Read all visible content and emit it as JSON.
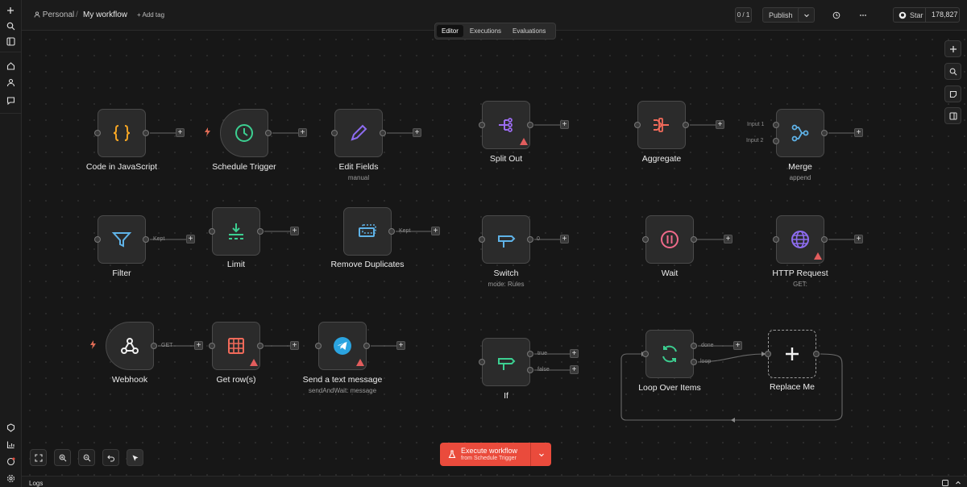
{
  "breadcrumb": {
    "project": "Personal",
    "separator": "/",
    "workflow": "My workflow",
    "add_tag": "+ Add tag"
  },
  "header": {
    "counter": "0 / 1",
    "publish_label": "Publish",
    "star_label": "Star",
    "star_count": "178,827"
  },
  "tabs": [
    {
      "label": "Editor",
      "active": true
    },
    {
      "label": "Executions",
      "active": false
    },
    {
      "label": "Evaluations",
      "active": false
    }
  ],
  "nodes": {
    "code": {
      "label": "Code in JavaScript"
    },
    "schedule": {
      "label": "Schedule Trigger"
    },
    "edit_fields": {
      "label": "Edit Fields",
      "sub": "manual"
    },
    "split_out": {
      "label": "Split Out"
    },
    "aggregate": {
      "label": "Aggregate"
    },
    "merge": {
      "label": "Merge",
      "sub": "append",
      "input1": "Input 1",
      "input2": "Input 2"
    },
    "filter": {
      "label": "Filter",
      "edge": "Kept"
    },
    "limit": {
      "label": "Limit"
    },
    "remove_dup": {
      "label": "Remove Duplicates",
      "edge": "Kept"
    },
    "switch": {
      "label": "Switch",
      "sub": "mode: Rules",
      "edge": "0"
    },
    "wait": {
      "label": "Wait"
    },
    "http": {
      "label": "HTTP Request",
      "sub": "GET:"
    },
    "webhook": {
      "label": "Webhook",
      "edge": "GET"
    },
    "get_rows": {
      "label": "Get row(s)"
    },
    "send_text": {
      "label": "Send a text message",
      "sub": "sendAndWait: message"
    },
    "if": {
      "label": "If",
      "edge_true": "true",
      "edge_false": "false"
    },
    "loop": {
      "label": "Loop Over Items",
      "edge_done": "done",
      "edge_loop": "loop"
    },
    "replace": {
      "label": "Replace Me"
    }
  },
  "execute": {
    "title": "Execute workflow",
    "subtitle": "from Schedule Trigger"
  },
  "logs": {
    "label": "Logs"
  },
  "colors": {
    "accent": "#ea4b3c",
    "warning": "#e25d5d",
    "code": "#f5a524",
    "schedule": "#3ccf91",
    "edit": "#8d6cf0",
    "split": "#9b6cf0",
    "aggregate": "#f06a5a",
    "merge": "#5fb3e8",
    "filter": "#5fb3e8",
    "limit": "#3ccf91",
    "dedupe": "#5fb3e8",
    "switch": "#5fb3e8",
    "wait": "#f06a8a",
    "http": "#8d6cf0",
    "sheet": "#f06a5a",
    "telegram": "#2ba4e0",
    "loop": "#3ccf91"
  }
}
